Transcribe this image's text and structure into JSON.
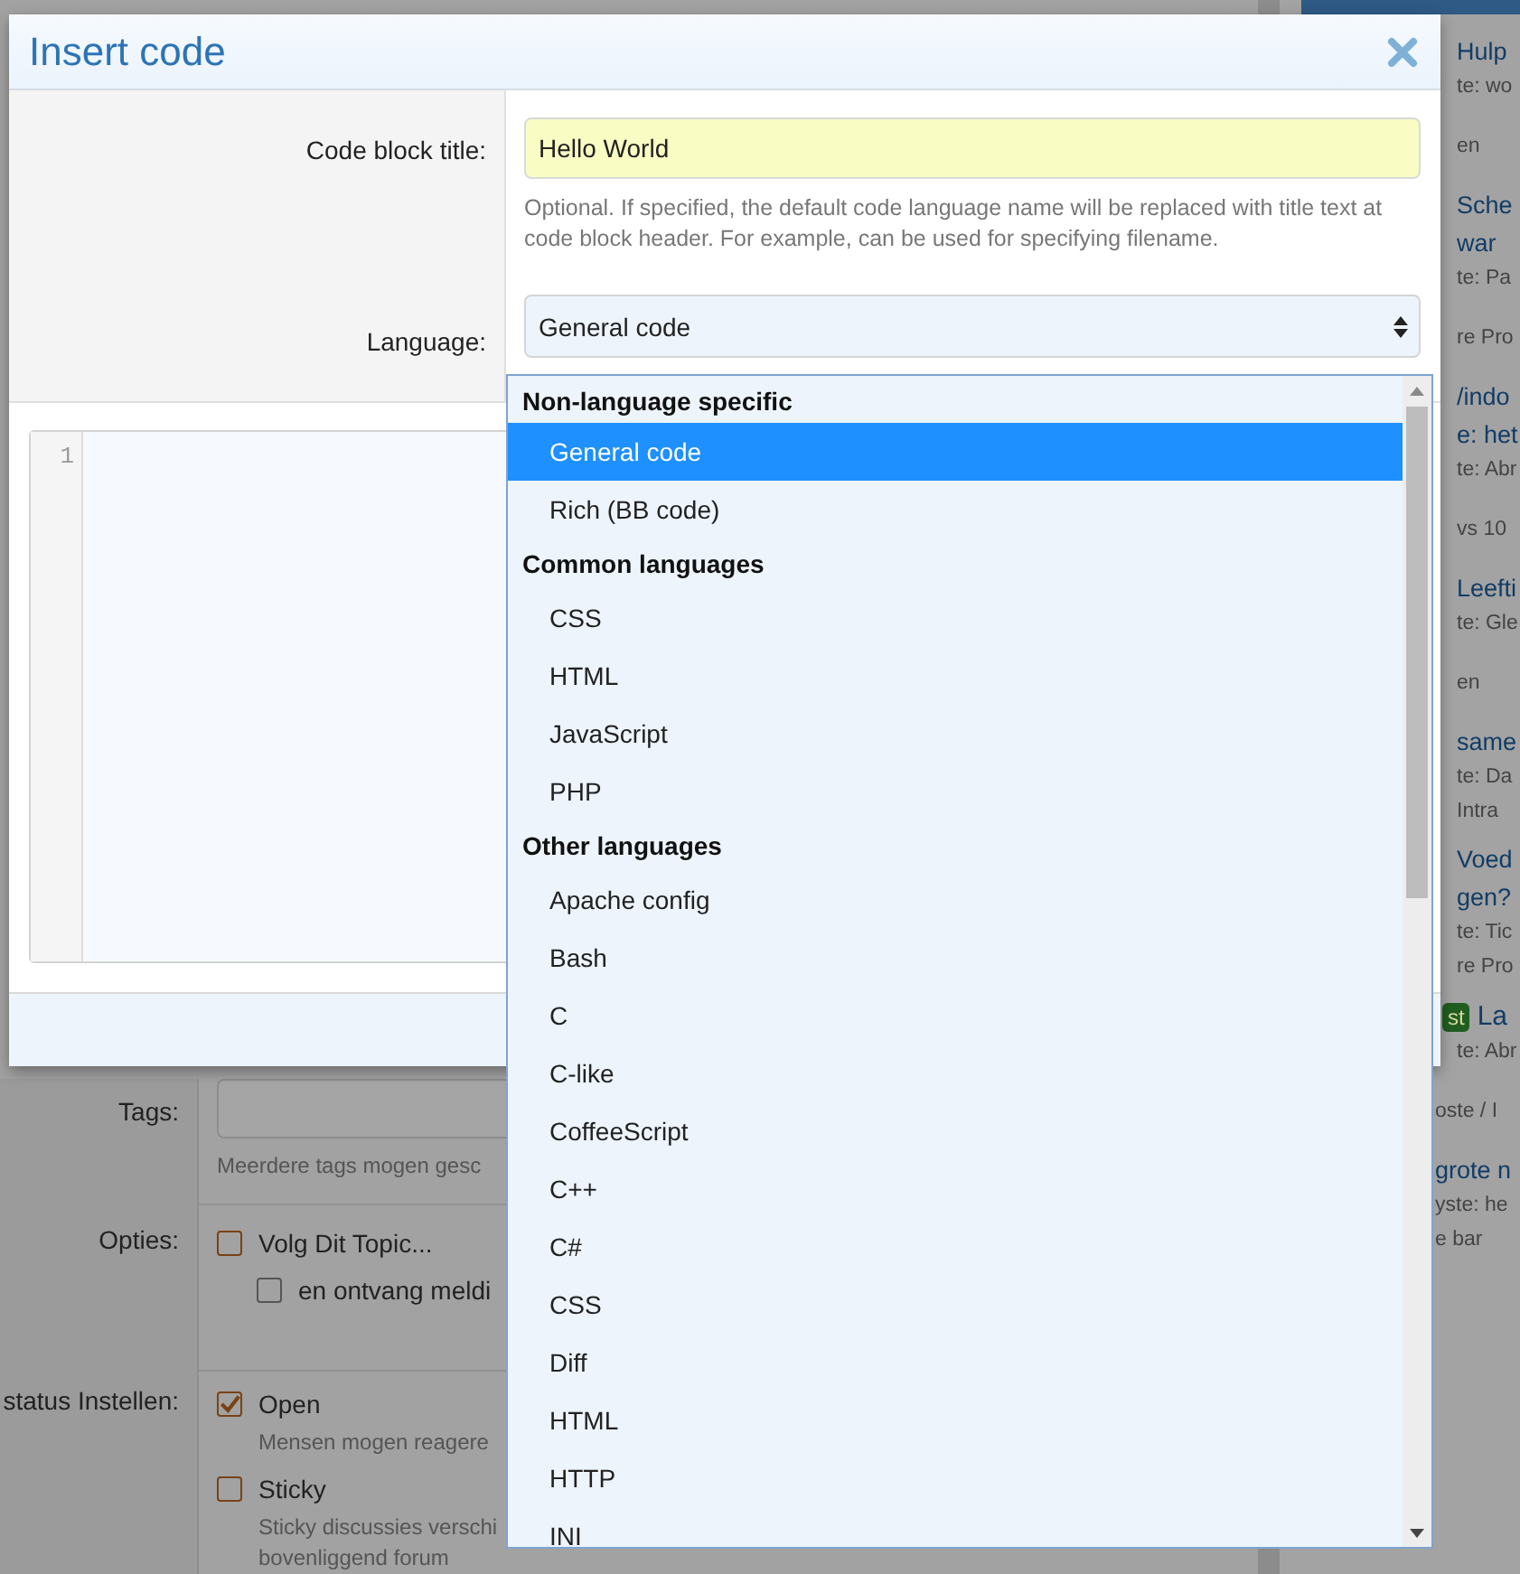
{
  "page": {
    "form_rows": [
      {
        "kind": "input",
        "label": "Tags:",
        "help": "Meerdere tags mogen gesc"
      },
      {
        "kind": "checks",
        "label": "Opties:",
        "items": [
          {
            "label": "Volg Dit Topic...",
            "checked": false,
            "nested": false
          },
          {
            "label": "en ontvang meldi",
            "checked": false,
            "nested": true
          }
        ]
      },
      {
        "kind": "checks",
        "label": "status Instellen:",
        "items": [
          {
            "label": "Open",
            "checked": true,
            "nested": false,
            "help": "Mensen mogen reagere"
          },
          {
            "label": "Sticky",
            "checked": false,
            "nested": false,
            "help": "Sticky discussies verschi bovenliggend forum"
          }
        ]
      }
    ],
    "sidebar": [
      {
        "kind": "link",
        "text": "Hulp"
      },
      {
        "kind": "meta",
        "text": "te: wo"
      },
      {
        "kind": "section",
        "text": "en"
      },
      {
        "kind": "link",
        "text": "Sche"
      },
      {
        "kind": "link",
        "text": "war"
      },
      {
        "kind": "meta",
        "text": "te: Pa"
      },
      {
        "kind": "section",
        "text": "re Pro"
      },
      {
        "kind": "link",
        "text": "/indo"
      },
      {
        "kind": "link",
        "text": "e: het"
      },
      {
        "kind": "meta",
        "text": "te: Abr"
      },
      {
        "kind": "section",
        "text": "vs 10"
      },
      {
        "kind": "link",
        "text": "Leefti"
      },
      {
        "kind": "meta",
        "text": "te: Gle"
      },
      {
        "kind": "section",
        "text": "en"
      },
      {
        "kind": "link",
        "text": "same"
      },
      {
        "kind": "meta",
        "text": "te: Da"
      },
      {
        "kind": "meta",
        "text": "Intra"
      },
      {
        "kind": "link",
        "text": "Voed"
      },
      {
        "kind": "link",
        "text": "gen?"
      },
      {
        "kind": "meta",
        "text": "te: Tic"
      },
      {
        "kind": "meta",
        "text": "re Pro"
      },
      {
        "kind": "badge_link",
        "badge": "st",
        "text": "La"
      },
      {
        "kind": "meta",
        "text": "te: Abr"
      },
      {
        "kind": "section",
        "text": "oste / I"
      },
      {
        "kind": "link",
        "text": "grote n"
      },
      {
        "kind": "meta",
        "text": "yste: he"
      },
      {
        "kind": "meta",
        "text": "e bar"
      }
    ]
  },
  "dialog": {
    "title": "Insert code",
    "title_field": {
      "label": "Code block title:",
      "value": "Hello World",
      "help": "Optional. If specified, the default code language name will be replaced with title text at code block header. For example, can be used for specifying filename."
    },
    "language_field": {
      "label": "Language:",
      "value": "General code"
    },
    "editor": {
      "line_numbers": [
        "1"
      ]
    }
  },
  "dropdown": {
    "groups": [
      {
        "label": "Non-language specific",
        "options": [
          {
            "label": "General code",
            "selected": true
          },
          {
            "label": "Rich (BB code)",
            "selected": false
          }
        ]
      },
      {
        "label": "Common languages",
        "options": [
          {
            "label": "CSS",
            "selected": false
          },
          {
            "label": "HTML",
            "selected": false
          },
          {
            "label": "JavaScript",
            "selected": false
          },
          {
            "label": "PHP",
            "selected": false
          }
        ]
      },
      {
        "label": "Other languages",
        "options": [
          {
            "label": "Apache config",
            "selected": false
          },
          {
            "label": "Bash",
            "selected": false
          },
          {
            "label": "C",
            "selected": false
          },
          {
            "label": "C-like",
            "selected": false
          },
          {
            "label": "CoffeeScript",
            "selected": false
          },
          {
            "label": "C++",
            "selected": false
          },
          {
            "label": "C#",
            "selected": false
          },
          {
            "label": "CSS",
            "selected": false
          },
          {
            "label": "Diff",
            "selected": false
          },
          {
            "label": "HTML",
            "selected": false
          },
          {
            "label": "HTTP",
            "selected": false
          },
          {
            "label": "INI",
            "selected": false
          }
        ]
      }
    ]
  }
}
